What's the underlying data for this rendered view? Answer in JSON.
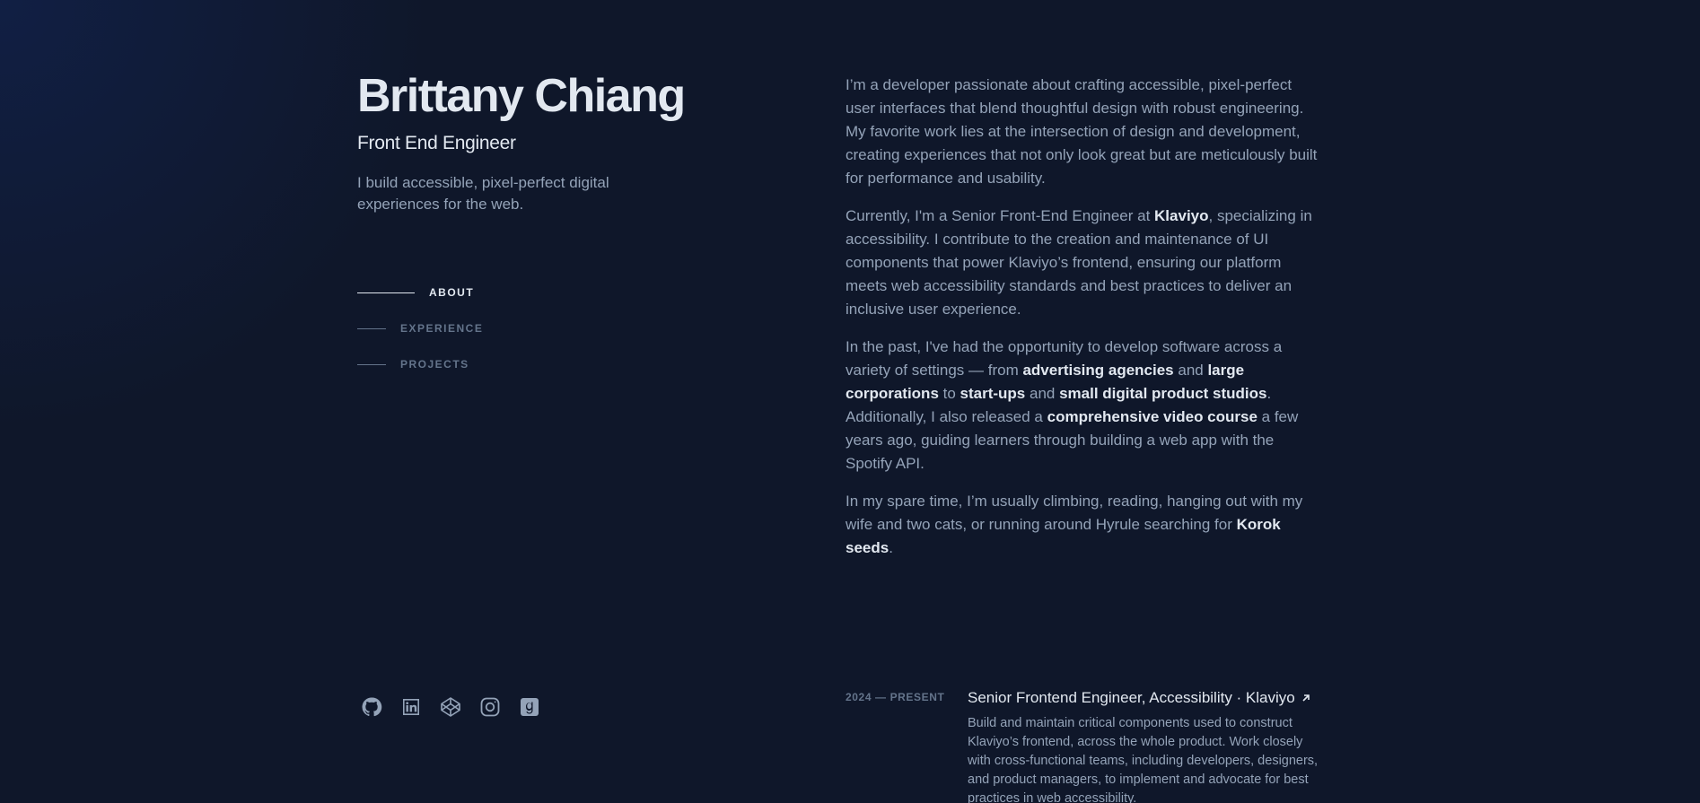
{
  "header": {
    "name": "Brittany Chiang",
    "role": "Front End Engineer",
    "tagline": "I build accessible, pixel-perfect digital experiences for the web."
  },
  "nav": {
    "items": [
      {
        "label": "ABOUT",
        "active": true
      },
      {
        "label": "EXPERIENCE",
        "active": false
      },
      {
        "label": "PROJECTS",
        "active": false
      }
    ]
  },
  "socials": [
    {
      "icon": "github-icon"
    },
    {
      "icon": "linkedin-icon"
    },
    {
      "icon": "codepen-icon"
    },
    {
      "icon": "instagram-icon"
    },
    {
      "icon": "goodreads-icon"
    }
  ],
  "about": {
    "p1": "I’m a developer passionate about crafting accessible, pixel-perfect user interfaces that blend thoughtful design with robust engineering. My favorite work lies at the intersection of design and development, creating experiences that not only look great but are meticulously built for performance and usability.",
    "p2_a": "Currently, I'm a Senior Front-End Engineer at ",
    "p2_link": "Klaviyo",
    "p2_b": ", specializing in accessibility. I contribute to the creation and maintenance of UI components that power Klaviyo’s frontend, ensuring our platform meets web accessibility standards and best practices to deliver an inclusive user experience.",
    "p3_a": "In the past, I've had the opportunity to develop software across a variety of settings — from ",
    "p3_l1": "advertising agencies",
    "p3_b": " and ",
    "p3_l2": "large corporations",
    "p3_c": " to ",
    "p3_l3": "start-ups",
    "p3_d": " and ",
    "p3_l4": "small digital product studios",
    "p3_e": ". Additionally, I also released a ",
    "p3_l5": "comprehensive video course",
    "p3_f": " a few years ago, guiding learners through building a web app with the Spotify API.",
    "p4_a": "In my spare time, I’m usually climbing, reading, hanging out with my wife and two cats, or running around Hyrule searching for ",
    "p4_link": "Korok seeds",
    "p4_b": "."
  },
  "experience": {
    "date": "2024 — PRESENT",
    "title": "Senior Frontend Engineer, Accessibility · Klaviyo",
    "description": "Build and maintain critical components used to construct Klaviyo’s frontend, across the whole product. Work closely with cross-functional teams, including developers, designers, and product managers, to implement and advocate for best practices in web accessibility."
  },
  "colors": {
    "background": "#0f172a",
    "heading": "#e2e8f0",
    "body": "#94a3b8",
    "muted": "#64748b"
  }
}
